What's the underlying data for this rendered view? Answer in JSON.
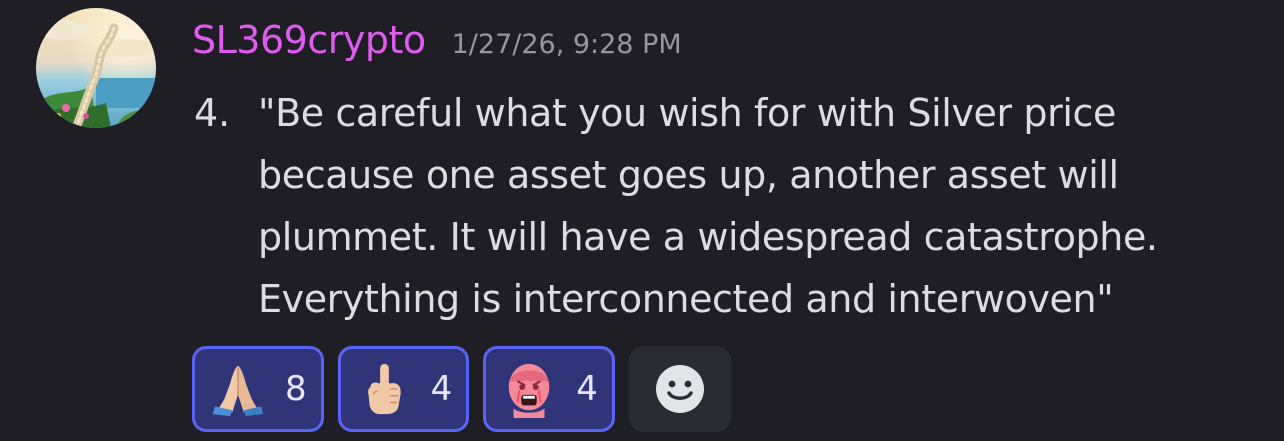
{
  "message": {
    "username": "SL369crypto",
    "timestamp": "1/27/26, 9:28 PM",
    "list_number": "4.",
    "text": "\"Be careful what you wish for with Silver price because one asset goes up, another asset will plummet. It will have a widespread catastrophe. Everything is interconnected and interwoven\""
  },
  "reactions": [
    {
      "emoji": "folded-hands-emoji",
      "count": "8"
    },
    {
      "emoji": "pointing-up-hand-emoji",
      "count": "4"
    },
    {
      "emoji": "crying-wojak-emoji",
      "count": "4"
    }
  ],
  "add_reaction_icon": "smiley-face-icon",
  "colors": {
    "background": "#1e1e24",
    "username": "#e05cf0",
    "timestamp": "#96979f",
    "text": "#dcdde1",
    "reaction_border": "#5865f2",
    "reaction_bg": "#30357a",
    "add_reaction_bg": "#2b2c33"
  }
}
